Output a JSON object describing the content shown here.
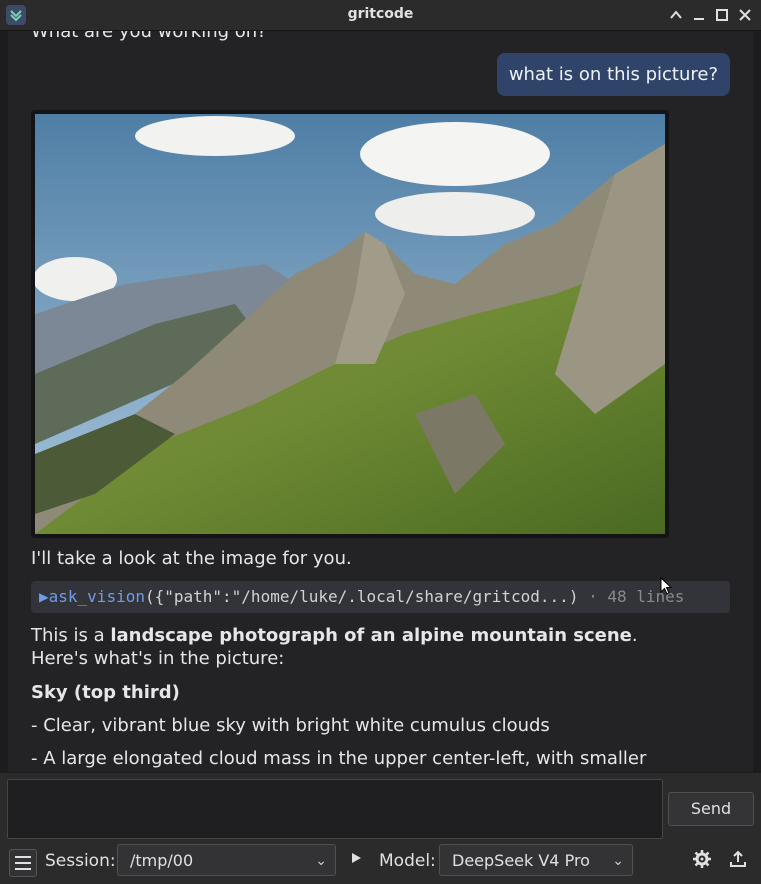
{
  "window": {
    "title": "gritcode"
  },
  "chat": {
    "partial_top_line": "What are you working on?",
    "user_message": "what is on this picture?",
    "assistant_intro": "I'll take a look at the image for you.",
    "tool_call": {
      "name": "ask_vision",
      "args": "({\"path\":\"/home/luke/.local/share/gritcod...)",
      "meta": " · 48 lines"
    },
    "response": {
      "lead": "This is a ",
      "bold": "landscape photograph of an alpine mountain scene",
      "tail": ".",
      "line2": "Here's what's in the picture:",
      "heading": "Sky (top third)",
      "bullet1": "- Clear, vibrant blue sky with bright white cumulus clouds",
      "bullet2": "- A large elongated cloud mass in the upper center-left, with smaller"
    }
  },
  "composer": {
    "send_label": "Send",
    "session_label": "Session:",
    "session_value": "/tmp/00",
    "model_label": "Model:",
    "model_value": "DeepSeek V4 Pro"
  },
  "icons": {
    "app": "chevron-down-icon",
    "menu": "hamburger-icon",
    "play": "play-icon",
    "settings": "gear-icon",
    "export": "upload-icon"
  },
  "colors": {
    "user_bubble": "#30446a",
    "tool_accent": "#6f9be8",
    "background": "#232326"
  }
}
